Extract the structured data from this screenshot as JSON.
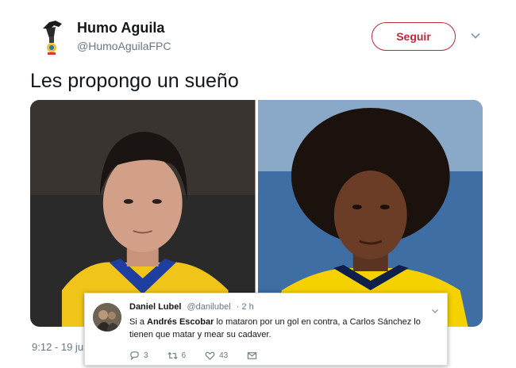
{
  "author": {
    "name": "Humo Aguila",
    "handle": "@HumoAguilaFPC"
  },
  "follow_button": {
    "label": "Seguir"
  },
  "tweet": {
    "text": "Les propongo un sueño",
    "timestamp": "9:12 - 19 ju"
  },
  "reply": {
    "name": "Daniel Lubel",
    "handle": "@danilubel",
    "time": "· 2 h",
    "text_before": "Si a ",
    "text_bold": "Andrés Escobar",
    "text_after": " lo mataron por un gol en contra, a Carlos Sánchez lo tienen que matar y mear su cadaver.",
    "replies": "3",
    "retweets": "6",
    "likes": "43"
  },
  "colors": {
    "follow_accent": "#b92a3a",
    "secondary_text": "#657786",
    "primary_text": "#14171a"
  },
  "icons": [
    "caret-down-icon",
    "reply-icon",
    "retweet-icon",
    "like-icon",
    "message-icon"
  ]
}
